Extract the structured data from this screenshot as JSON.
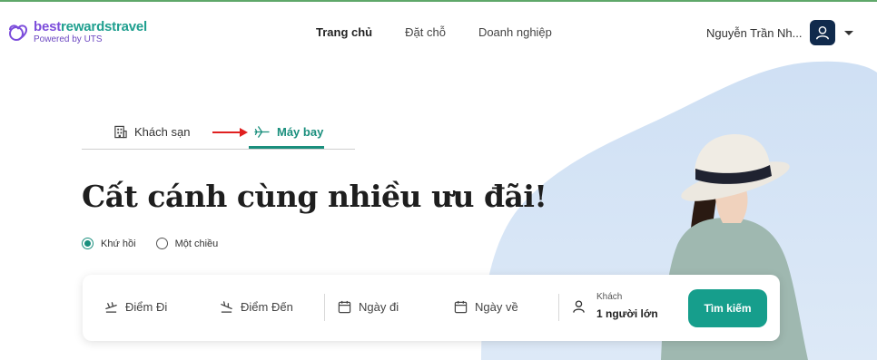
{
  "brand": {
    "name_part1": "best",
    "name_part2": "rewardstravel",
    "subtitle": "Powered by UTS"
  },
  "nav": {
    "items": [
      {
        "label": "Trang chủ",
        "active": true
      },
      {
        "label": "Đặt chỗ",
        "active": false
      },
      {
        "label": "Doanh nghiệp",
        "active": false
      }
    ]
  },
  "user": {
    "name": "Nguyễn Trần Nh..."
  },
  "tabs": [
    {
      "label": "Khách sạn",
      "icon": "building-icon",
      "active": false
    },
    {
      "label": "Máy bay",
      "icon": "airplane-icon",
      "active": true
    }
  ],
  "hero": {
    "headline": "Cất cánh cùng nhiều ưu đãi!"
  },
  "trip_type": {
    "options": [
      {
        "label": "Khứ hồi",
        "selected": true
      },
      {
        "label": "Một chiều",
        "selected": false
      }
    ]
  },
  "search": {
    "origin_placeholder": "Điểm Đi",
    "destination_placeholder": "Điểm Đến",
    "depart_placeholder": "Ngày đi",
    "return_placeholder": "Ngày về",
    "guests_label": "Khách",
    "guests_value": "1 người lớn",
    "button_label": "Tìm kiếm"
  },
  "colors": {
    "accent": "#169e8c",
    "brand_purple": "#7c4ddb",
    "avatar_bg": "#102a4c"
  }
}
